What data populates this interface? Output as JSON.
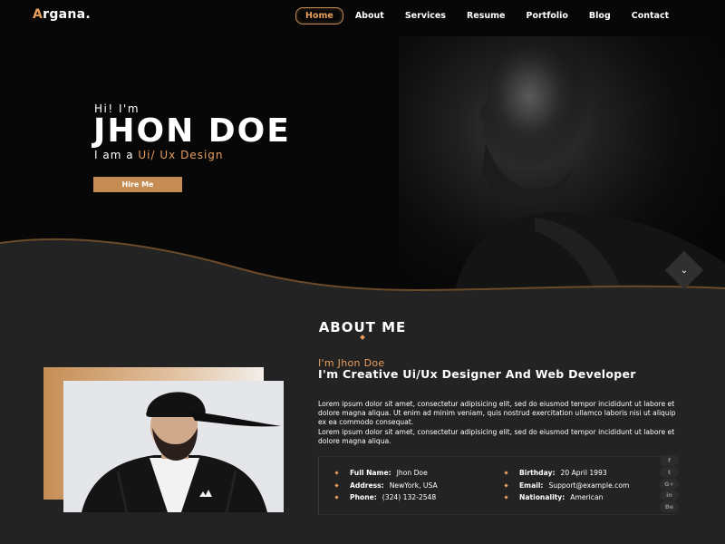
{
  "brand": {
    "logo_first": "A",
    "logo_rest": "rgana."
  },
  "nav": {
    "items": [
      {
        "label": "Home",
        "active": true
      },
      {
        "label": "About",
        "active": false
      },
      {
        "label": "Services",
        "active": false
      },
      {
        "label": "Resume",
        "active": false
      },
      {
        "label": "Portfolio",
        "active": false
      },
      {
        "label": "Blog",
        "active": false
      },
      {
        "label": "Contact",
        "active": false
      }
    ]
  },
  "hero": {
    "greeting": "Hi! I'm",
    "name": "JHON DOE",
    "iam_prefix": "I am a ",
    "role": "Ui/ Ux Design",
    "hire_button": "Hire Me",
    "scroll_icon": "chevron-down-icon"
  },
  "about": {
    "title": "ABOUT ME",
    "intro_small": "I'm Jhon Doe",
    "intro_big": "I'm Creative Ui/Ux Designer And Web Developer",
    "paragraph1": "Lorem ipsum dolor sit amet, consectetur adipisicing elit, sed do eiusmod tempor incididunt ut labore et dolore magna aliqua. Ut enim ad minim veniam, quis nostrud exercitation ullamco laboris nisi ut aliquip ex ea commodo consequat.",
    "paragraph2": "Lorem ipsum dolor sit amet, consectetur adipisicing elit, sed do eiusmod tempor incididunt ut labore et dolore magna aliqua.",
    "info": {
      "full_name": {
        "label": "Full Name:",
        "value": "Jhon Doe"
      },
      "birthday": {
        "label": "Birthday:",
        "value": "20 April 1993"
      },
      "address": {
        "label": "Address:",
        "value": "NewYork, USA"
      },
      "email": {
        "label": "Email:",
        "value": "Support@example.com"
      },
      "phone": {
        "label": "Phone:",
        "value": "(324) 132-2548"
      },
      "nationality": {
        "label": "Nationality:",
        "value": "American"
      }
    }
  },
  "socials": [
    {
      "icon": "facebook-icon",
      "glyph": "f"
    },
    {
      "icon": "twitter-icon",
      "glyph": "t"
    },
    {
      "icon": "google-plus-icon",
      "glyph": "G+"
    },
    {
      "icon": "linkedin-icon",
      "glyph": "in"
    },
    {
      "icon": "behance-icon",
      "glyph": "Be"
    }
  ],
  "colors": {
    "accent": "#e89e5d",
    "accent_dark": "#c58d54",
    "background": "#232323",
    "hero_background": "#070707"
  }
}
